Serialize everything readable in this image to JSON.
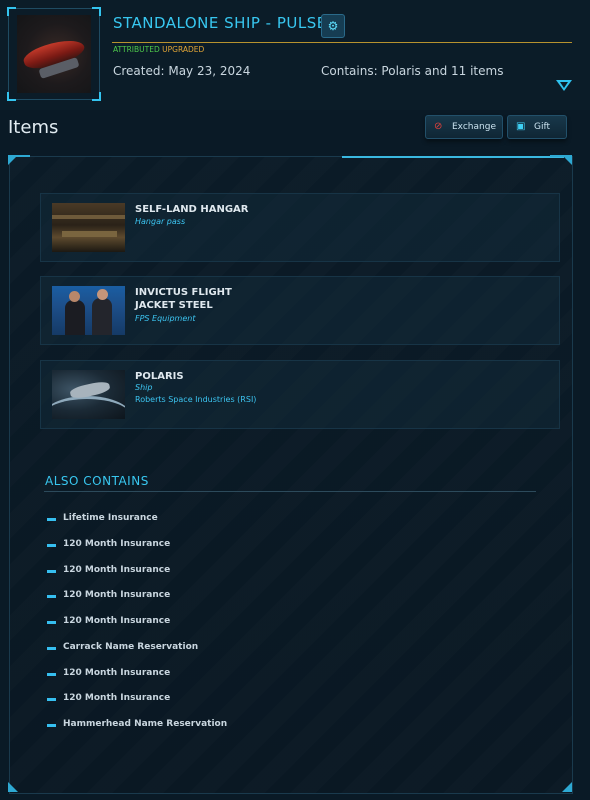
{
  "pledge": {
    "title": "STANDALONE SHIP - PULSE",
    "badge_attributed": "ATTRIBUTED",
    "badge_upgraded": "UPGRADED",
    "created": "Created: May 23, 2024",
    "contains": "Contains: Polaris and 11 items"
  },
  "items_section": {
    "title": "Items",
    "exchange_label": "Exchange",
    "gift_label": "Gift"
  },
  "items": [
    {
      "name": "SELF-LAND HANGAR",
      "type": "Hangar pass",
      "manufacturer": ""
    },
    {
      "name": "INVICTUS FLIGHT JACKET STEEL",
      "type": "FPS Equipment",
      "manufacturer": ""
    },
    {
      "name": "POLARIS",
      "type": "Ship",
      "manufacturer": "Roberts Space Industries (RSI)"
    }
  ],
  "also_contains": {
    "title": "ALSO CONTAINS",
    "items": [
      "Lifetime Insurance",
      "120 Month Insurance",
      "120 Month Insurance",
      "120 Month Insurance",
      "120 Month Insurance",
      "Carrack Name Reservation",
      "120 Month Insurance",
      "120 Month Insurance",
      "Hammerhead Name Reservation"
    ]
  },
  "colors": {
    "accent": "#38c7f0",
    "badge_attributed": "#4ec94b",
    "badge_upgraded": "#e0a436",
    "gold_rule": "#b7922e"
  },
  "icons": {
    "title_button": "chip-icon",
    "expand": "triangle-down-icon",
    "exchange": "no-entry-icon",
    "gift": "gift-icon"
  }
}
